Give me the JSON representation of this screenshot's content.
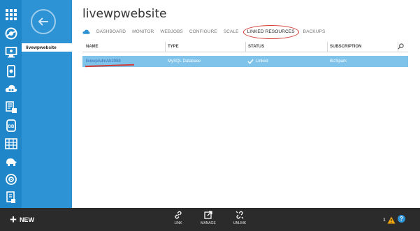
{
  "sidebar": {
    "back_label": "",
    "selected_item": "livewpwebsite"
  },
  "header": {
    "title": "livewpwebsite"
  },
  "tabs": [
    {
      "label": "DASHBOARD"
    },
    {
      "label": "MONITOR"
    },
    {
      "label": "WEBJOBS"
    },
    {
      "label": "CONFIGURE"
    },
    {
      "label": "SCALE"
    },
    {
      "label": "LINKED RESOURCES",
      "active": true
    },
    {
      "label": "BACKUPS"
    }
  ],
  "table": {
    "columns": [
      "NAME",
      "TYPE",
      "STATUS",
      "SUBSCRIPTION"
    ],
    "rows": [
      {
        "name": "livewpAdmAh2988",
        "type": "MySQL Database",
        "status": "Linked",
        "subscription": "BizSpark"
      }
    ]
  },
  "bottom_bar": {
    "new_label": "NEW",
    "link_label": "LINK",
    "manage_label": "MANAGE",
    "unlink_label": "UNLINK",
    "alert_count": "1",
    "help_label": "?"
  },
  "colors": {
    "rail": "#1f86c9",
    "sidebar": "#2d93d4",
    "selected_row": "#7fc3ea",
    "annotation": "#d23a33",
    "bottom_bar": "#2b2b2b"
  },
  "icons": [
    "all-items-icon",
    "web-sites-icon",
    "virtual-machines-icon",
    "mobile-services-icon",
    "cloud-services-icon",
    "batch-icon",
    "sql-databases-icon",
    "storage-icon",
    "hdinsight-icon",
    "media-services-icon",
    "service-bus-icon"
  ]
}
